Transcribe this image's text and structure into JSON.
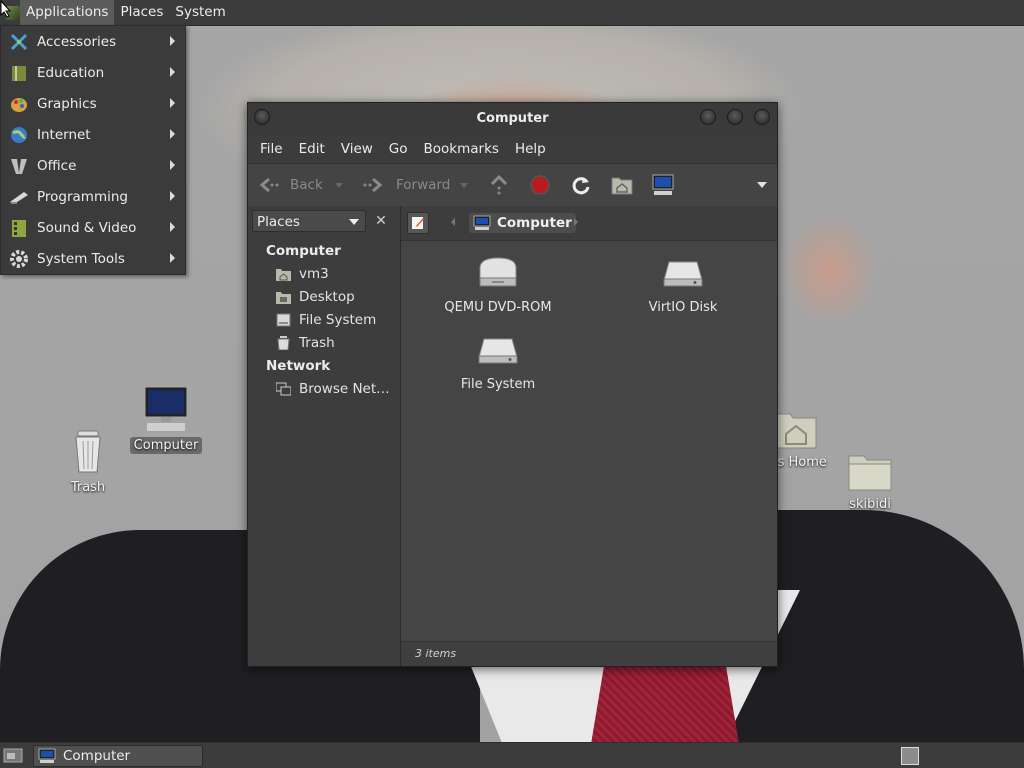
{
  "top_panel": {
    "menus": [
      "Applications",
      "Places",
      "System"
    ]
  },
  "applications_menu": {
    "items": [
      {
        "label": "Accessories",
        "icon": "accessories-icon"
      },
      {
        "label": "Education",
        "icon": "education-icon"
      },
      {
        "label": "Graphics",
        "icon": "graphics-icon"
      },
      {
        "label": "Internet",
        "icon": "internet-icon"
      },
      {
        "label": "Office",
        "icon": "office-icon"
      },
      {
        "label": "Programming",
        "icon": "programming-icon"
      },
      {
        "label": "Sound & Video",
        "icon": "sound-video-icon"
      },
      {
        "label": "System Tools",
        "icon": "system-tools-icon"
      }
    ]
  },
  "desktop": {
    "icons": [
      {
        "label": "Computer",
        "icon": "computer-icon"
      },
      {
        "label": "Trash",
        "icon": "trash-icon"
      },
      {
        "label": "'s Home",
        "icon": "home-folder-icon"
      },
      {
        "label": "skibidi",
        "icon": "folder-icon"
      }
    ]
  },
  "window": {
    "title": "Computer",
    "menubar": [
      "File",
      "Edit",
      "View",
      "Go",
      "Bookmarks",
      "Help"
    ],
    "toolbar": {
      "back": "Back",
      "forward": "Forward"
    },
    "sidebar": {
      "mode": "Places",
      "sections": [
        {
          "heading": "Computer",
          "items": [
            {
              "label": "vm3",
              "icon": "home-icon"
            },
            {
              "label": "Desktop",
              "icon": "desktop-folder-icon"
            },
            {
              "label": "File System",
              "icon": "filesystem-icon"
            },
            {
              "label": "Trash",
              "icon": "trash-icon"
            }
          ]
        },
        {
          "heading": "Network",
          "items": [
            {
              "label": "Browse Net…",
              "icon": "network-icon"
            }
          ]
        }
      ]
    },
    "path": {
      "current": "Computer"
    },
    "items": [
      {
        "label": "QEMU DVD-ROM",
        "icon": "optical-drive-icon"
      },
      {
        "label": "VirtIO Disk",
        "icon": "hard-disk-icon"
      },
      {
        "label": "File System",
        "icon": "hard-disk-icon"
      }
    ],
    "status": "3 items"
  },
  "taskbar": {
    "tasks": [
      {
        "label": "Computer"
      }
    ]
  },
  "colors": {
    "panel": "#3c3c3c",
    "menu_active": "#5b5b5b",
    "window_bg": "#454545"
  }
}
